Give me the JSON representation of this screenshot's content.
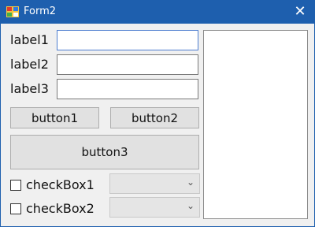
{
  "window": {
    "title": "Form2",
    "close_glyph": "✕",
    "app_icon": "app-icon"
  },
  "labels": [
    "label1",
    "label2",
    "label3"
  ],
  "textboxes": [
    "",
    "",
    ""
  ],
  "buttons": {
    "button1": "button1",
    "button2": "button2",
    "button3": "button3"
  },
  "checkboxes": [
    {
      "label": "checkBox1",
      "checked": false
    },
    {
      "label": "checkBox2",
      "checked": false
    }
  ],
  "combos": [
    {
      "selected": "",
      "arrow": "⌄"
    },
    {
      "selected": "",
      "arrow": "⌄"
    }
  ],
  "listbox": {
    "items": []
  },
  "colors": {
    "titlebar": "#1e5fae",
    "client": "#f0f0f0"
  }
}
